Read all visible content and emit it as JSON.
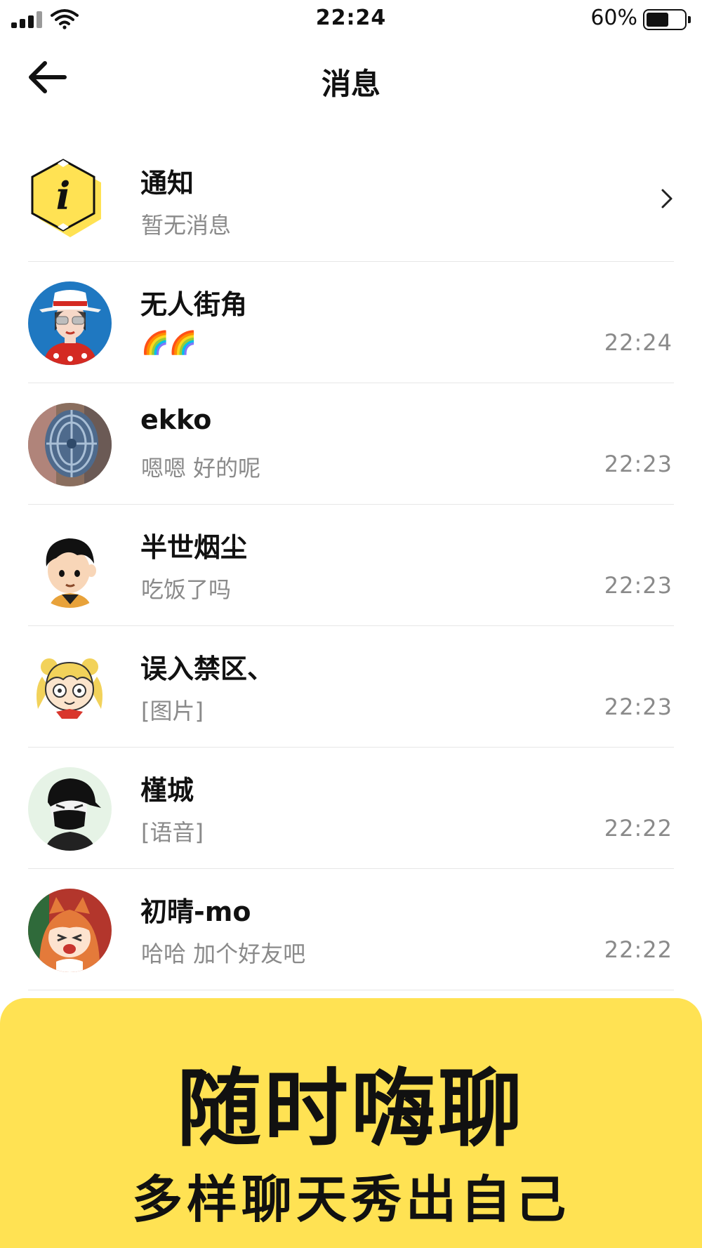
{
  "status_bar": {
    "time": "22:24",
    "battery_text": "60%",
    "battery_level": 0.6,
    "icons": [
      "signal-icon",
      "wifi-icon",
      "battery-icon"
    ]
  },
  "nav": {
    "title": "消息",
    "back_icon": "back-arrow-icon"
  },
  "notice": {
    "title": "通知",
    "preview": "暂无消息",
    "icon": "info-hexagon-icon",
    "chevron_icon": "chevron-right-icon",
    "accent_color": "#ffe253"
  },
  "messages": [
    {
      "name": "无人街角",
      "preview": "🌈🌈",
      "time": "22:24",
      "avatar": "avatar-woman-hat"
    },
    {
      "name": "ekko",
      "preview": "嗯嗯 好的呢",
      "time": "22:23",
      "avatar": "avatar-fan-photo"
    },
    {
      "name": "半世烟尘",
      "preview": "吃饭了吗",
      "time": "22:23",
      "avatar": "avatar-cartoon-boy"
    },
    {
      "name": "误入禁区、",
      "preview": "[图片]",
      "time": "22:23",
      "avatar": "avatar-anime-girl"
    },
    {
      "name": "槿城",
      "preview": "[语音]",
      "time": "22:22",
      "avatar": "avatar-masked-boy"
    },
    {
      "name": "初晴-mo",
      "preview": "哈哈 加个好友吧",
      "time": "22:22",
      "avatar": "avatar-umaru"
    }
  ],
  "promo": {
    "title": "随时嗨聊",
    "subtitle": "多样聊天秀出自己",
    "background_color": "#ffe253"
  }
}
